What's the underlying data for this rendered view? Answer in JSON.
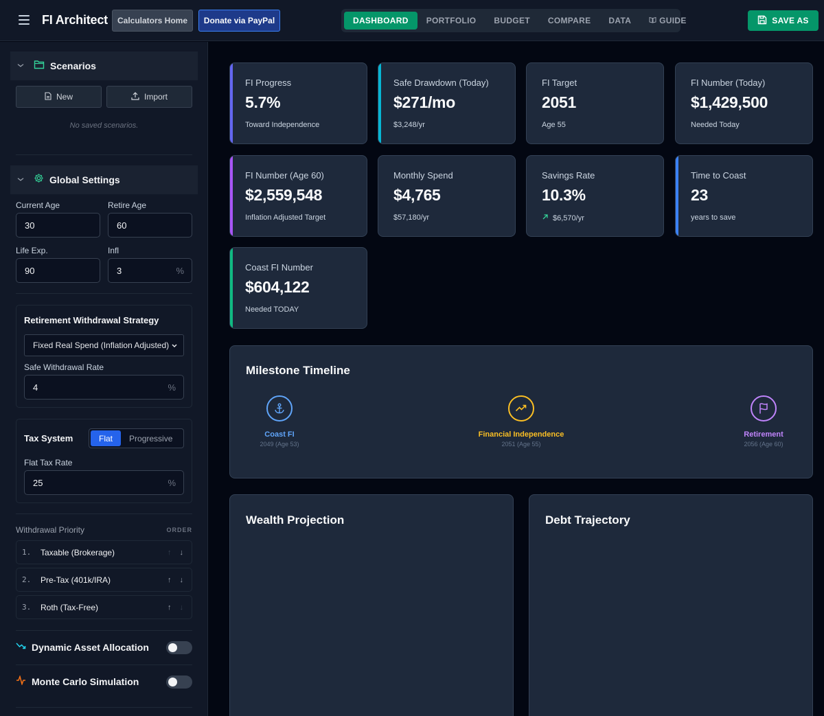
{
  "header": {
    "brand": "FI Architect",
    "calc_home": "Calculators Home",
    "donate": "Donate via PayPal",
    "tabs": [
      {
        "label": "DASHBOARD",
        "active": true
      },
      {
        "label": "PORTFOLIO",
        "active": false
      },
      {
        "label": "BUDGET",
        "active": false
      },
      {
        "label": "COMPARE",
        "active": false
      },
      {
        "label": "DATA",
        "active": false
      },
      {
        "label": "GUIDE",
        "active": false
      }
    ],
    "save_as": "SAVE AS"
  },
  "sidebar": {
    "scenarios": {
      "title": "Scenarios",
      "new_label": "New",
      "import_label": "Import",
      "empty_note": "No saved scenarios."
    },
    "global": {
      "title": "Global Settings",
      "current_age_label": "Current Age",
      "current_age": "30",
      "retire_age_label": "Retire Age",
      "retire_age": "60",
      "life_exp_label": "Life Exp.",
      "life_exp": "90",
      "infl_label": "Infl",
      "infl": "3",
      "percent": "%"
    },
    "withdrawal": {
      "title": "Retirement Withdrawal Strategy",
      "strategy": "Fixed Real Spend (Inflation Adjusted)",
      "swr_label": "Safe Withdrawal Rate",
      "swr": "4"
    },
    "tax": {
      "title": "Tax System",
      "options": [
        "Flat",
        "Progressive"
      ],
      "selected": "Flat",
      "flat_label": "Flat Tax Rate",
      "flat_rate": "25"
    },
    "priority": {
      "title": "Withdrawal Priority",
      "order_label": "ORDER",
      "items": [
        {
          "num": "1.",
          "label": "Taxable (Brokerage)"
        },
        {
          "num": "2.",
          "label": "Pre-Tax (401k/IRA)"
        },
        {
          "num": "3.",
          "label": "Roth (Tax-Free)"
        }
      ]
    },
    "toggles": {
      "dynamic": {
        "label": "Dynamic Asset Allocation",
        "on": false
      },
      "monte_carlo": {
        "label": "Monte Carlo Simulation",
        "on": false
      }
    }
  },
  "stats": [
    {
      "label": "FI Progress",
      "value": "5.7%",
      "sub": "Toward Independence",
      "accent": "#6366f1"
    },
    {
      "label": "Safe Drawdown (Today)",
      "value": "$271/mo",
      "sub": "$3,248/yr",
      "accent": "#06b6d4"
    },
    {
      "label": "FI Target",
      "value": "2051",
      "sub": "Age 55",
      "accent": ""
    },
    {
      "label": "FI Number (Today)",
      "value": "$1,429,500",
      "sub": "Needed Today",
      "accent": ""
    },
    {
      "label": "FI Number (Age 60)",
      "value": "$2,559,548",
      "sub": "Inflation Adjusted Target",
      "accent": "#a855f7"
    },
    {
      "label": "Monthly Spend",
      "value": "$4,765",
      "sub": "$57,180/yr",
      "accent": ""
    },
    {
      "label": "Savings Rate",
      "value": "10.3%",
      "sub": "$6,570/yr",
      "accent": ""
    },
    {
      "label": "Time to Coast",
      "value": "23",
      "sub": "years to save",
      "accent": "#3b82f6"
    },
    {
      "label": "Coast FI Number",
      "value": "$604,122",
      "sub": "Needed TODAY",
      "accent": "#10b981"
    }
  ],
  "milestones": {
    "title": "Milestone Timeline",
    "items": [
      {
        "name": "Coast FI",
        "sub": "2049 (Age 53)",
        "color": "#60a5fa",
        "icon": "anchor-icon"
      },
      {
        "name": "Financial Independence",
        "sub": "2051 (Age 55)",
        "color": "#fbbf24",
        "icon": "trending-up-icon"
      },
      {
        "name": "Retirement",
        "sub": "2056 (Age 60)",
        "color": "#c084fc",
        "icon": "flag-icon"
      }
    ]
  },
  "panels": {
    "wealth": "Wealth Projection",
    "debt": "Debt Trajectory"
  }
}
